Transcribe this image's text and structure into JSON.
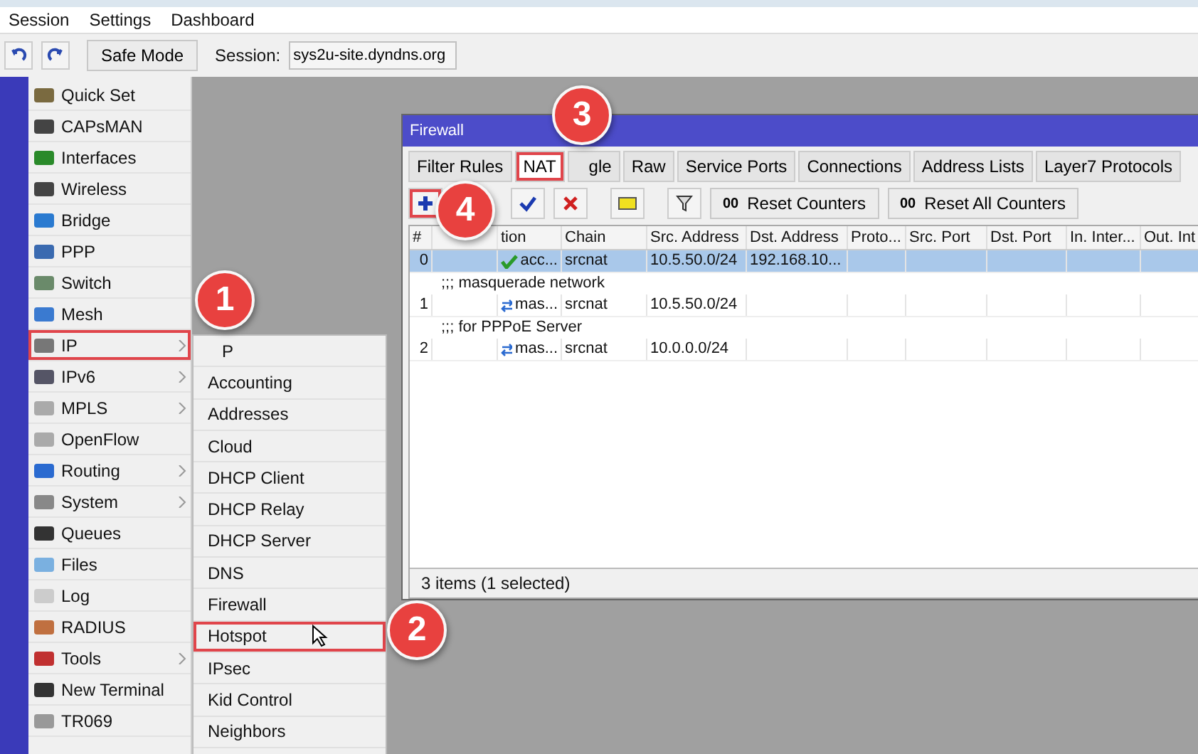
{
  "menu_bar": [
    "Session",
    "Settings",
    "Dashboard"
  ],
  "toolbar": {
    "safe_mode": "Safe Mode",
    "session_label": "Session:",
    "session_value": "sys2u-site.dyndns.org"
  },
  "sidebar": {
    "items": [
      {
        "label": "Quick Set",
        "submenu": false,
        "highlighted": false
      },
      {
        "label": "CAPsMAN",
        "submenu": false,
        "highlighted": false
      },
      {
        "label": "Interfaces",
        "submenu": false,
        "highlighted": false
      },
      {
        "label": "Wireless",
        "submenu": false,
        "highlighted": false
      },
      {
        "label": "Bridge",
        "submenu": false,
        "highlighted": false
      },
      {
        "label": "PPP",
        "submenu": false,
        "highlighted": false
      },
      {
        "label": "Switch",
        "submenu": false,
        "highlighted": false
      },
      {
        "label": "Mesh",
        "submenu": false,
        "highlighted": false
      },
      {
        "label": "IP",
        "submenu": true,
        "highlighted": true
      },
      {
        "label": "IPv6",
        "submenu": true,
        "highlighted": false
      },
      {
        "label": "MPLS",
        "submenu": true,
        "highlighted": false
      },
      {
        "label": "OpenFlow",
        "submenu": false,
        "highlighted": false
      },
      {
        "label": "Routing",
        "submenu": true,
        "highlighted": false
      },
      {
        "label": "System",
        "submenu": true,
        "highlighted": false
      },
      {
        "label": "Queues",
        "submenu": false,
        "highlighted": false
      },
      {
        "label": "Files",
        "submenu": false,
        "highlighted": false
      },
      {
        "label": "Log",
        "submenu": false,
        "highlighted": false
      },
      {
        "label": "RADIUS",
        "submenu": false,
        "highlighted": false
      },
      {
        "label": "Tools",
        "submenu": true,
        "highlighted": false
      },
      {
        "label": "New Terminal",
        "submenu": false,
        "highlighted": false
      },
      {
        "label": "TR069",
        "submenu": false,
        "highlighted": false
      }
    ]
  },
  "submenu": {
    "items": [
      {
        "label": "P",
        "highlighted": false
      },
      {
        "label": "Accounting",
        "highlighted": false
      },
      {
        "label": "Addresses",
        "highlighted": false
      },
      {
        "label": "Cloud",
        "highlighted": false
      },
      {
        "label": "DHCP Client",
        "highlighted": false
      },
      {
        "label": "DHCP Relay",
        "highlighted": false
      },
      {
        "label": "DHCP Server",
        "highlighted": false
      },
      {
        "label": "DNS",
        "highlighted": false
      },
      {
        "label": "Firewall",
        "highlighted": false
      },
      {
        "label": "Hotspot",
        "highlighted": true
      },
      {
        "label": "IPsec",
        "highlighted": false
      },
      {
        "label": "Kid Control",
        "highlighted": false
      },
      {
        "label": "Neighbors",
        "highlighted": false
      }
    ]
  },
  "firewall": {
    "title": "Firewall",
    "tabs": [
      {
        "label": "Filter Rules",
        "selected": false,
        "highlighted": false
      },
      {
        "label": "NAT",
        "selected": true,
        "highlighted": true
      },
      {
        "label": "gle",
        "selected": false,
        "highlighted": false
      },
      {
        "label": "Raw",
        "selected": false,
        "highlighted": false
      },
      {
        "label": "Service Ports",
        "selected": false,
        "highlighted": false
      },
      {
        "label": "Connections",
        "selected": false,
        "highlighted": false
      },
      {
        "label": "Address Lists",
        "selected": false,
        "highlighted": false
      },
      {
        "label": "Layer7 Protocols",
        "selected": false,
        "highlighted": false
      }
    ],
    "counter_buttons": [
      {
        "glyph": "00",
        "label": "Reset Counters"
      },
      {
        "glyph": "00",
        "label": "Reset All Counters"
      }
    ],
    "columns": [
      "#",
      "tion",
      "Chain",
      "Src. Address",
      "Dst. Address",
      "Proto...",
      "Src. Port",
      "Dst. Port",
      "In. Inter...",
      "Out. Int"
    ],
    "rows": [
      {
        "kind": "accept",
        "number": "0",
        "action": "acc...",
        "chain": "srcnat",
        "src": "10.5.50.0/24",
        "dst": "192.168.10...",
        "selected": true
      },
      {
        "kind": "comment",
        "text": ";;; masquerade network"
      },
      {
        "kind": "masquerade",
        "number": "1",
        "action": "mas...",
        "chain": "srcnat",
        "src": "10.5.50.0/24",
        "dst": "",
        "selected": false
      },
      {
        "kind": "comment",
        "text": ";;; for PPPoE Server"
      },
      {
        "kind": "masquerade",
        "number": "2",
        "action": "mas...",
        "chain": "srcnat",
        "src": "10.0.0.0/24",
        "dst": "",
        "selected": false
      }
    ],
    "status": "3 items (1 selected)"
  },
  "badges": [
    "1",
    "2",
    "3",
    "4"
  ]
}
